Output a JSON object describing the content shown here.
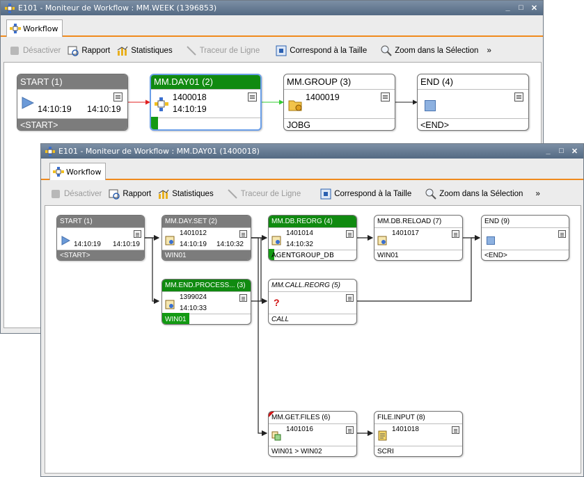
{
  "win1": {
    "title": "E101 - Moniteur de Workflow : MM.WEEK (1396853)",
    "tab": "Workflow",
    "toolbar": {
      "disable": "Désactiver",
      "report": "Rapport",
      "stats": "Statistiques",
      "trace": "Traceur de Ligne",
      "fit": "Correspond à la Taille",
      "zoom": "Zoom dans la Sélection",
      "more": "»"
    },
    "nodes": {
      "start": {
        "title": "START (1)",
        "t1": "14:10:19",
        "t2": "14:10:19",
        "footer": "<START>"
      },
      "day01": {
        "title": "MM.DAY01 (2)",
        "run": "1400018",
        "time": "14:10:19"
      },
      "group": {
        "title": "MM.GROUP (3)",
        "run": "1400019",
        "footer": "JOBG"
      },
      "end": {
        "title": "END (4)",
        "footer": "<END>"
      }
    }
  },
  "win2": {
    "title": "E101 - Moniteur de Workflow : MM.DAY01 (1400018)",
    "tab": "Workflow",
    "toolbar": {
      "disable": "Désactiver",
      "report": "Rapport",
      "stats": "Statistiques",
      "trace": "Traceur de Ligne",
      "fit": "Correspond à la Taille",
      "zoom": "Zoom dans la Sélection",
      "more": "»"
    },
    "nodes": {
      "start": {
        "title": "START (1)",
        "t1": "14:10:19",
        "t2": "14:10:19",
        "footer": "<START>"
      },
      "dayset": {
        "title": "MM.DAY.SET (2)",
        "run": "1401012",
        "t1": "14:10:19",
        "t2": "14:10:32",
        "footer": "WIN01"
      },
      "reorg": {
        "title": "MM.DB.REORG (4)",
        "run": "1401014",
        "time": "14:10:32",
        "footer": "AGENTGROUP_DB"
      },
      "reload": {
        "title": "MM.DB.RELOAD (7)",
        "run": "1401017",
        "footer": "WIN01"
      },
      "end": {
        "title": "END (9)",
        "footer": "<END>"
      },
      "endproc": {
        "title": "MM.END.PROCESS... (3)",
        "run": "1399024",
        "time": "14:10:33",
        "footer": "WIN01"
      },
      "callreorg": {
        "title": "MM.CALL.REORG (5)",
        "footer": "CALL",
        "glyph": "?"
      },
      "getfiles": {
        "title": "MM.GET.FILES (6)",
        "run": "1401016",
        "footer": "WIN01 > WIN02"
      },
      "fileinput": {
        "title": "FILE.INPUT (8)",
        "run": "1401018",
        "footer": "SCRI"
      }
    }
  },
  "colors": {
    "running": "#108a10",
    "selected": "#6a9ee8",
    "accent": "#f08a1c"
  }
}
